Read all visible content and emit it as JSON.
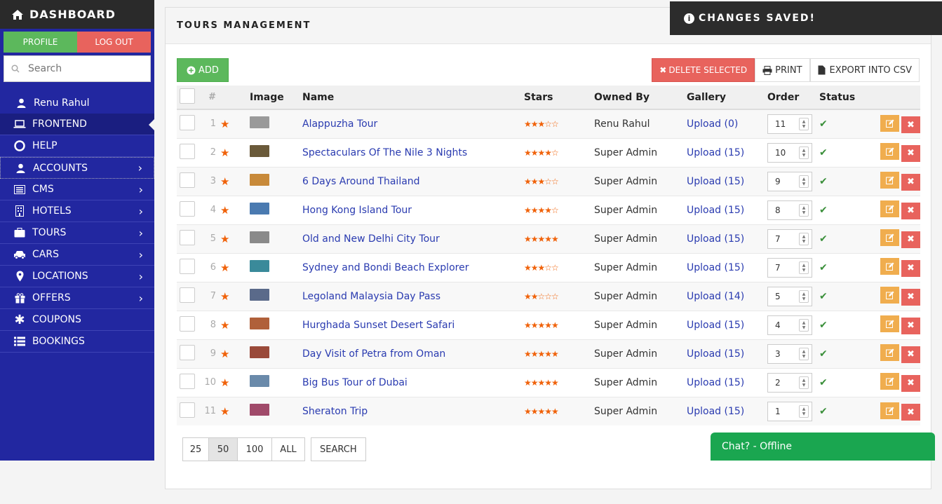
{
  "sidebar": {
    "brand": "DASHBOARD",
    "profile_label": "PROFILE",
    "logout_label": "LOG OUT",
    "search_placeholder": "Search",
    "user_name": "Renu Rahul",
    "items": [
      {
        "label": "FRONTEND",
        "icon": "laptop-icon"
      },
      {
        "label": "HELP",
        "icon": "lifebuoy-icon"
      },
      {
        "label": "ACCOUNTS",
        "icon": "user-icon"
      },
      {
        "label": "CMS",
        "icon": "list-icon"
      },
      {
        "label": "HOTELS",
        "icon": "building-icon"
      },
      {
        "label": "TOURS",
        "icon": "suitcase-icon"
      },
      {
        "label": "CARS",
        "icon": "car-icon"
      },
      {
        "label": "LOCATIONS",
        "icon": "map-marker-icon"
      },
      {
        "label": "OFFERS",
        "icon": "gift-icon"
      },
      {
        "label": "COUPONS",
        "icon": "asterisk-icon"
      },
      {
        "label": "BOOKINGS",
        "icon": "list-icon"
      }
    ]
  },
  "panel": {
    "title": "TOURS MANAGEMENT",
    "add_label": "ADD",
    "delete_label": "DELETE SELECTED",
    "print_label": "PRINT",
    "export_label": "EXPORT INTO CSV"
  },
  "table": {
    "headers": [
      "#",
      "Image",
      "Name",
      "Stars",
      "Owned By",
      "Gallery",
      "Order",
      "Status"
    ],
    "rows": [
      {
        "num": "1",
        "name": "Alappuzha Tour",
        "stars": 3,
        "owner": "Renu Rahul",
        "gallery": "Upload (0)",
        "order": "11",
        "thumb": "#9a9a9a"
      },
      {
        "num": "2",
        "name": "Spectaculars Of The Nile 3 Nights",
        "stars": 4,
        "owner": "Super Admin",
        "gallery": "Upload (15)",
        "order": "10",
        "thumb": "#6a5a3a"
      },
      {
        "num": "3",
        "name": "6 Days Around Thailand",
        "stars": 3,
        "owner": "Super Admin",
        "gallery": "Upload (15)",
        "order": "9",
        "thumb": "#c88a3a"
      },
      {
        "num": "4",
        "name": "Hong Kong Island Tour",
        "stars": 4,
        "owner": "Super Admin",
        "gallery": "Upload (15)",
        "order": "8",
        "thumb": "#4a7ab0"
      },
      {
        "num": "5",
        "name": "Old and New Delhi City Tour",
        "stars": 5,
        "owner": "Super Admin",
        "gallery": "Upload (15)",
        "order": "7",
        "thumb": "#8a8a8a"
      },
      {
        "num": "6",
        "name": "Sydney and Bondi Beach Explorer",
        "stars": 3,
        "owner": "Super Admin",
        "gallery": "Upload (15)",
        "order": "7",
        "thumb": "#3a8a9a"
      },
      {
        "num": "7",
        "name": "Legoland Malaysia Day Pass",
        "stars": 2,
        "owner": "Super Admin",
        "gallery": "Upload (14)",
        "order": "5",
        "thumb": "#5a6a8a"
      },
      {
        "num": "8",
        "name": "Hurghada Sunset Desert Safari",
        "stars": 5,
        "owner": "Super Admin",
        "gallery": "Upload (15)",
        "order": "4",
        "thumb": "#b0603a"
      },
      {
        "num": "9",
        "name": "Day Visit of Petra from Oman",
        "stars": 5,
        "owner": "Super Admin",
        "gallery": "Upload (15)",
        "order": "3",
        "thumb": "#9a4a3a"
      },
      {
        "num": "10",
        "name": "Big Bus Tour of Dubai",
        "stars": 5,
        "owner": "Super Admin",
        "gallery": "Upload (15)",
        "order": "2",
        "thumb": "#6a8aaa"
      },
      {
        "num": "11",
        "name": "Sheraton Trip",
        "stars": 5,
        "owner": "Super Admin",
        "gallery": "Upload (15)",
        "order": "1",
        "thumb": "#a04a6a"
      }
    ]
  },
  "pager": {
    "sizes": [
      "25",
      "50",
      "100",
      "ALL"
    ],
    "active": "50",
    "search_label": "SEARCH"
  },
  "toast": {
    "text": "CHANGES SAVED!"
  },
  "chat": {
    "label": "Chat? - Offline"
  },
  "colors": {
    "sidebar": "#2227a0",
    "star": "#f0620a",
    "link": "#2a3bb0",
    "success": "#5cb85c",
    "danger": "#e8635d",
    "warning": "#f0ad4e"
  }
}
